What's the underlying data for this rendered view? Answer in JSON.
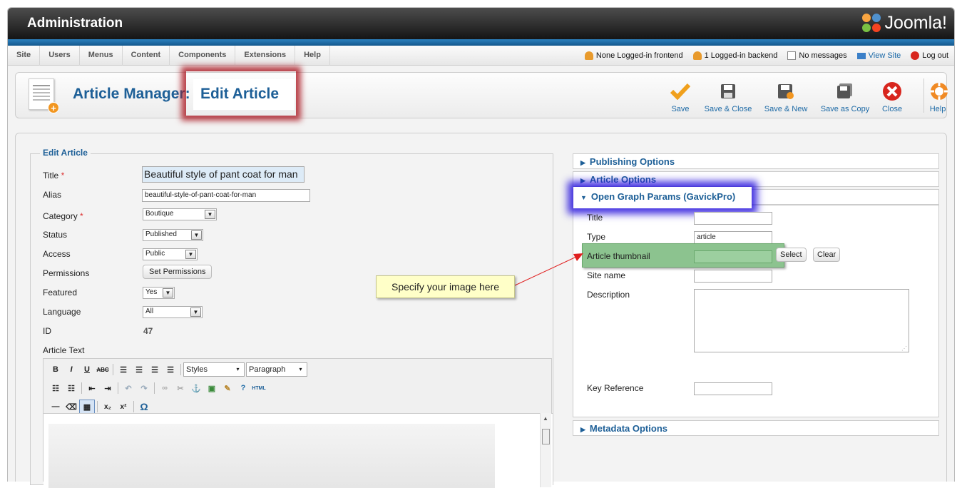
{
  "header": {
    "title": "Administration",
    "logo_text": "Joomla!"
  },
  "menu": {
    "items": [
      "Site",
      "Users",
      "Menus",
      "Content",
      "Components",
      "Extensions",
      "Help"
    ],
    "status": {
      "frontend": "None Logged-in frontend",
      "backend": "1 Logged-in backend",
      "messages": "No messages",
      "view_site": "View Site",
      "logout": "Log out"
    }
  },
  "toolbar": {
    "title_prefix": "Article Manager",
    "title_suffix": "Edit Article",
    "buttons": [
      "Save",
      "Save & Close",
      "Save & New",
      "Save as Copy",
      "Close",
      "Help"
    ]
  },
  "form": {
    "legend": "Edit Article",
    "title_label": "Title",
    "title_value": "Beautiful style of pant coat for man",
    "alias_label": "Alias",
    "alias_value": "beautiful-style-of-pant-coat-for-man",
    "category_label": "Category",
    "category_value": "Boutique",
    "status_label": "Status",
    "status_value": "Published",
    "access_label": "Access",
    "access_value": "Public",
    "permissions_label": "Permissions",
    "permissions_button": "Set Permissions",
    "featured_label": "Featured",
    "featured_value": "Yes",
    "language_label": "Language",
    "language_value": "All",
    "id_label": "ID",
    "id_value": "47",
    "article_text_label": "Article Text",
    "styles_value": "Styles",
    "paragraph_value": "Paragraph"
  },
  "panels": {
    "publishing": "Publishing Options",
    "article": "Article Options",
    "open_graph": "Open Graph Params (GavickPro)",
    "metadata": "Metadata Options"
  },
  "og": {
    "title_label": "Title",
    "type_label": "Type",
    "type_value": "article",
    "thumbnail_label": "Article thumbnail",
    "select_button": "Select",
    "clear_button": "Clear",
    "site_name_label": "Site name",
    "description_label": "Description",
    "key_reference_label": "Key Reference"
  },
  "callout": {
    "text": "Specify your image here"
  },
  "colors": {
    "accent_blue": "#1d5f97",
    "highlight_red": "#aa141e",
    "highlight_blue": "#2814dc",
    "highlight_green": "#8cc38f"
  }
}
